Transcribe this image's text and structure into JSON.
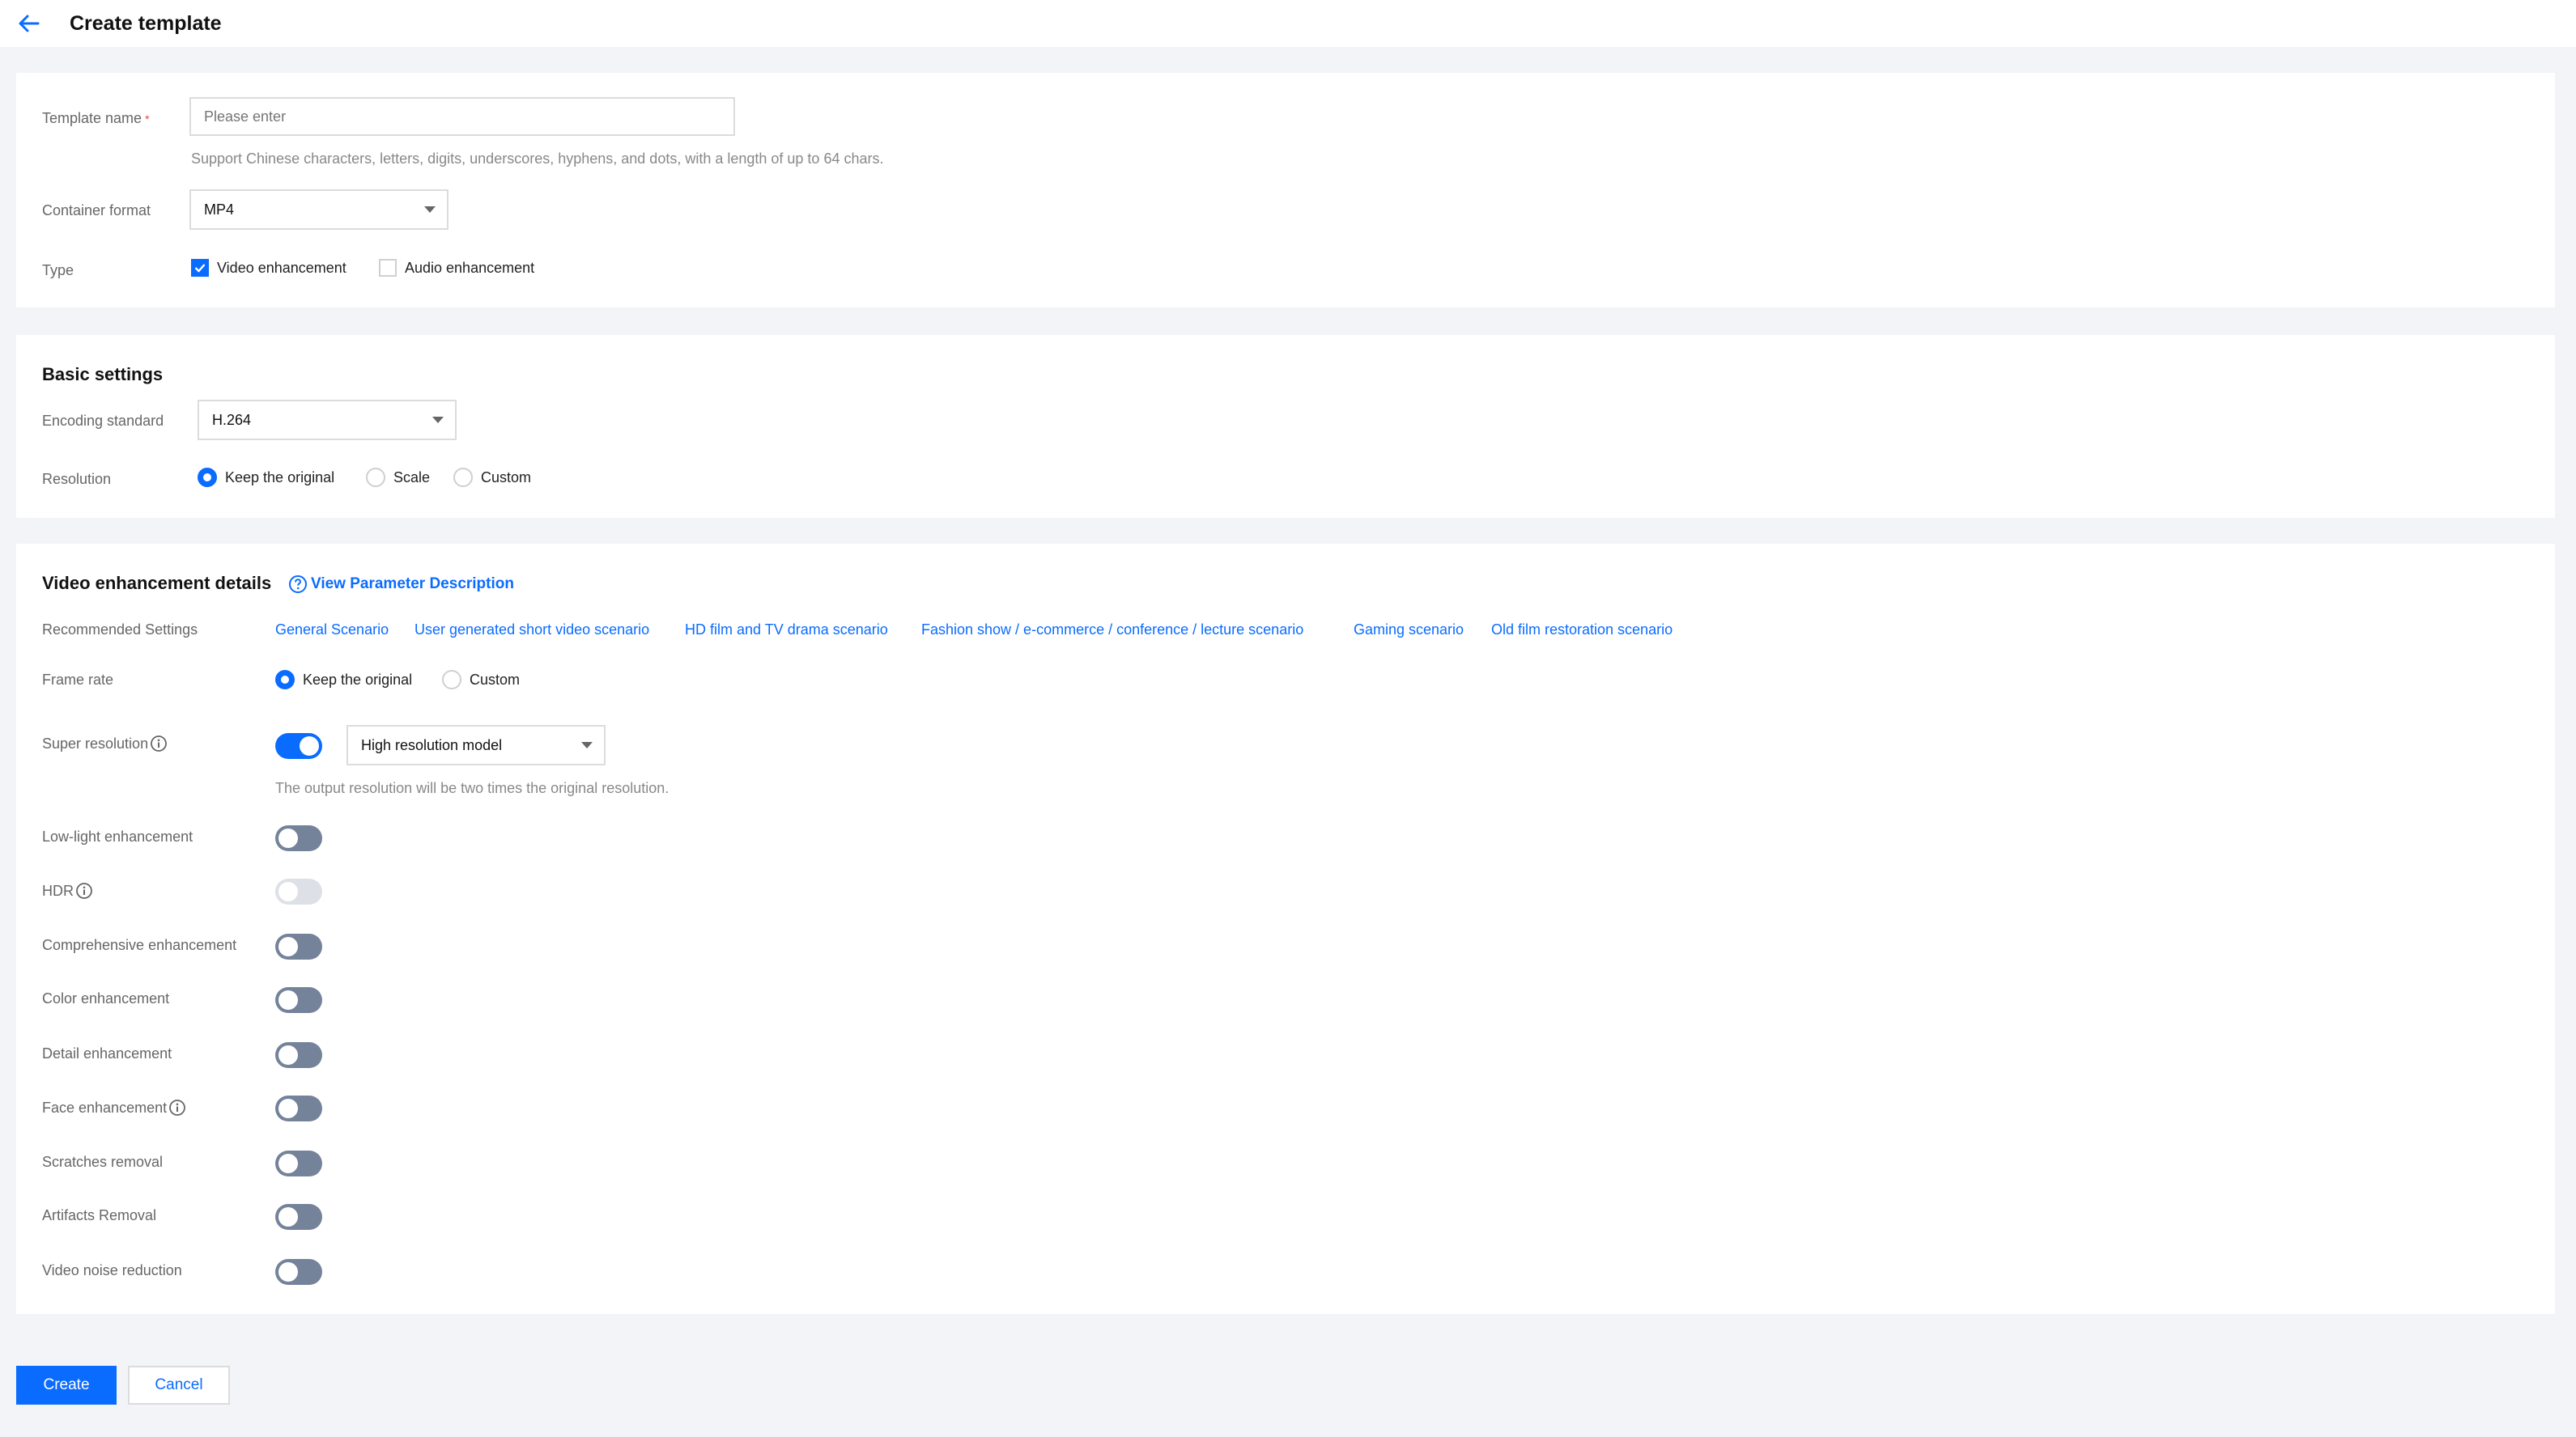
{
  "header": {
    "title": "Create template"
  },
  "form": {
    "template_name": {
      "label": "Template name",
      "placeholder": "Please enter",
      "value": "",
      "hint": "Support Chinese characters, letters, digits, underscores, hyphens, and dots, with a length of up to 64 chars."
    },
    "container_format": {
      "label": "Container format",
      "value": "MP4"
    },
    "type": {
      "label": "Type",
      "options": [
        {
          "label": "Video enhancement",
          "checked": true
        },
        {
          "label": "Audio enhancement",
          "checked": false
        }
      ]
    }
  },
  "basic": {
    "title": "Basic settings",
    "encoding": {
      "label": "Encoding standard",
      "value": "H.264"
    },
    "resolution": {
      "label": "Resolution",
      "options": [
        "Keep the original",
        "Scale",
        "Custom"
      ],
      "selected": "Keep the original"
    }
  },
  "video": {
    "title": "Video enhancement details",
    "help_link": "View Parameter Description",
    "recommended": {
      "label": "Recommended Settings",
      "links": [
        "General Scenario",
        "User generated short video scenario",
        "HD film and TV drama scenario",
        "Fashion show / e-commerce / conference / lecture scenario",
        "Gaming scenario",
        "Old film restoration scenario"
      ]
    },
    "frame_rate": {
      "label": "Frame rate",
      "options": [
        "Keep the original",
        "Custom"
      ],
      "selected": "Keep the original"
    },
    "super_resolution": {
      "label": "Super resolution",
      "enabled": true,
      "model": "High resolution model",
      "hint": "The output resolution will be two times the original resolution."
    },
    "toggles": [
      {
        "label": "Low-light enhancement",
        "enabled": false,
        "disabled": false
      },
      {
        "label": "HDR",
        "enabled": false,
        "disabled": true
      },
      {
        "label": "Comprehensive enhancement",
        "enabled": false,
        "disabled": false
      },
      {
        "label": "Color enhancement",
        "enabled": false,
        "disabled": false
      },
      {
        "label": "Detail enhancement",
        "enabled": false,
        "disabled": false
      },
      {
        "label": "Face enhancement",
        "enabled": false,
        "disabled": false
      },
      {
        "label": "Scratches removal",
        "enabled": false,
        "disabled": false
      },
      {
        "label": "Artifacts Removal",
        "enabled": false,
        "disabled": false
      },
      {
        "label": "Video noise reduction",
        "enabled": false,
        "disabled": false
      }
    ]
  },
  "actions": {
    "create_label": "Create",
    "cancel_label": "Cancel"
  },
  "colors": {
    "accent": "#0a6cff",
    "toggle_off": "#74829a",
    "toggle_disabled": "#dde1e7",
    "required": "#e54545",
    "background": "#f2f4f8"
  },
  "icons": {
    "back": "arrow-left-icon",
    "help": "question-circle-icon",
    "info": "info-circle-icon",
    "check": "check-icon",
    "dropdown": "caret-down-icon"
  }
}
